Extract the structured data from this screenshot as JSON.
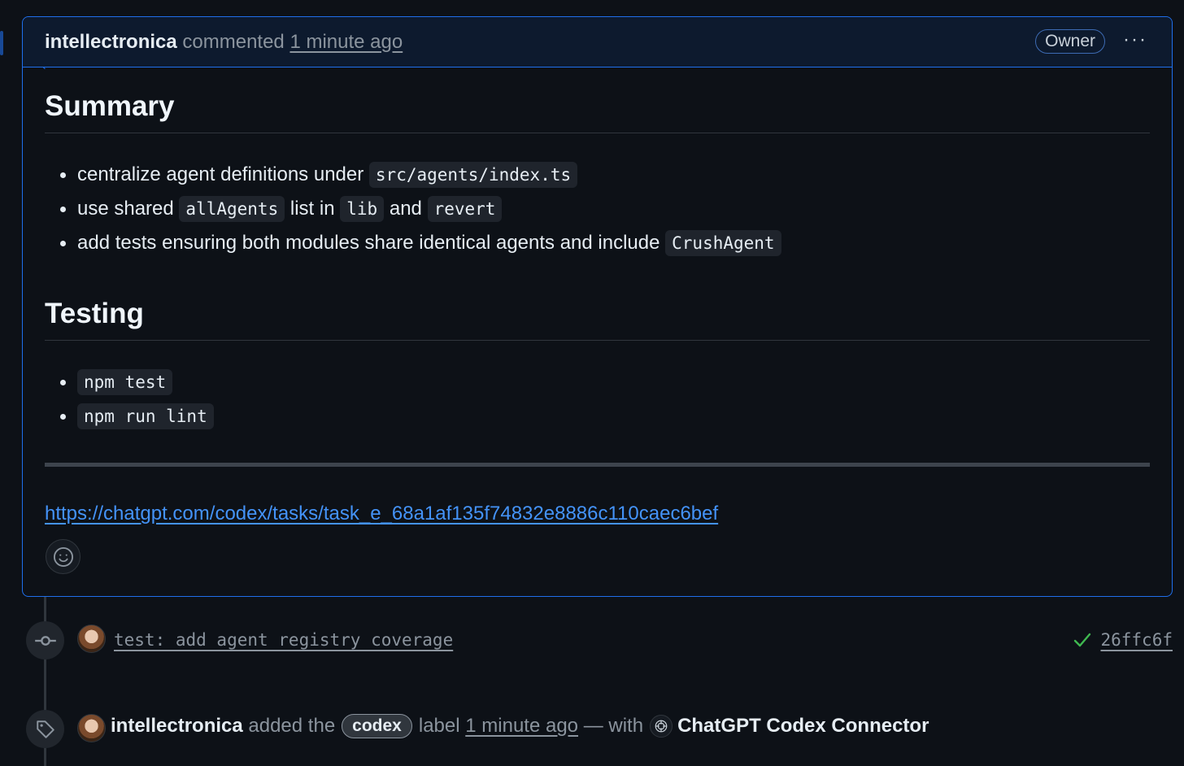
{
  "comment": {
    "author": "intellectronica",
    "action": "commented",
    "time": "1 minute ago",
    "role_badge": "Owner",
    "more_menu": "···",
    "summary": {
      "heading": "Summary",
      "items": [
        {
          "text": "centralize agent definitions under ",
          "code": "src/agents/index.ts"
        },
        {
          "t1": "use shared ",
          "c1": "allAgents",
          "t2": " list in ",
          "c2": "lib",
          "t3": " and ",
          "c3": "revert"
        },
        {
          "text": "add tests ensuring both modules share identical agents and include ",
          "code": "CrushAgent"
        }
      ]
    },
    "testing": {
      "heading": "Testing",
      "items": [
        "npm test",
        "npm run lint"
      ]
    },
    "task_link": "https://chatgpt.com/codex/tasks/task_e_68a1af135f74832e8886c110caec6bef",
    "reaction_icon": "smiley-icon"
  },
  "commit_event": {
    "icon": "git-commit-icon",
    "message": "test: add agent registry coverage",
    "status_icon": "check-icon",
    "status_color": "#3fb950",
    "sha": "26ffc6f"
  },
  "label_event": {
    "icon": "tag-icon",
    "author": "intellectronica",
    "text_before": "added the",
    "label": "codex",
    "text_after": "label",
    "time": "1 minute ago",
    "with_text": "— with",
    "app_name": "ChatGPT Codex Connector",
    "app_icon": "openai-icon"
  },
  "colors": {
    "accent_border": "#1f6feb",
    "link": "#4493f8",
    "background": "#0d1117"
  }
}
